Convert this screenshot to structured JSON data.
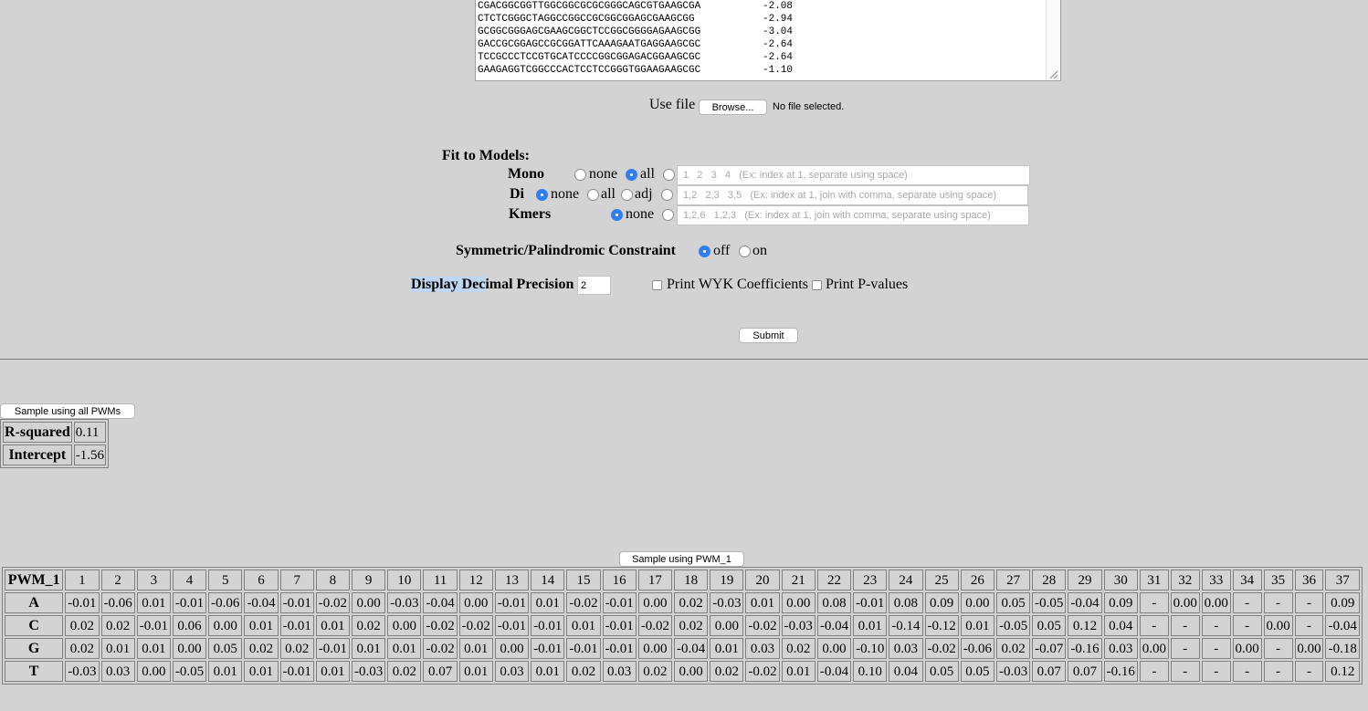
{
  "sequences": [
    {
      "seq": "CGACGGCGGTTGGCGGCGCGCGGGCAGCGTGAAGCGA",
      "score": "-2.08"
    },
    {
      "seq": "CTCTCGGGCTAGGCCGGCCGCGGCGGAGCGAAGCGG",
      "score": "-2.94"
    },
    {
      "seq": "GCGGCGGGAGCGAAGCGGCTCCGGCGGGGAGAAGCGG",
      "score": "-3.04"
    },
    {
      "seq": "GACCGCGGAGCCGCGGATTCAAAGAATGAGGAAGCGC",
      "score": "-2.64"
    },
    {
      "seq": "TCCGCCCTCCGTGCATCCCCGGCGGAGACGGAAGCGC",
      "score": "-2.64"
    },
    {
      "seq": "GAAGAGGTCGGCCCACTCCTCCGGGTGGAAGAAGCGC",
      "score": "-1.10"
    }
  ],
  "file": {
    "label": "Use file",
    "browse": "Browse...",
    "status": "No file selected."
  },
  "fit": {
    "title": "Fit to Models:",
    "mono": {
      "label": "Mono",
      "none": "none",
      "all": "all",
      "placeholder": "1   2   3   4   (Ex: index at 1, separate using space)"
    },
    "di": {
      "label": "Di",
      "none": "none",
      "all": "all",
      "adj": "adj",
      "placeholder": "1,2   2,3   3,5   (Ex: index at 1, join with comma, separate using space)"
    },
    "kmers": {
      "label": "Kmers",
      "none": "none",
      "placeholder": "1,2,6   1,2,3   (Ex: index at 1, join with comma, separate using space)"
    }
  },
  "symmetric": {
    "label": "Symmetric/Palindromic Constraint",
    "off": "off",
    "on": "on"
  },
  "precision": {
    "label_highlight": "Display Dec",
    "label_rest": "imal Precision",
    "value": "2"
  },
  "print_wyk": "Print WYK Coefficients",
  "print_pvalues": "Print P-values",
  "submit": "Submit",
  "sample_all": "Sample using all PWMs",
  "stats": [
    {
      "label": "R-squared",
      "value": "0.11"
    },
    {
      "label": "Intercept",
      "value": "-1.56"
    }
  ],
  "sample_pwm1": "Sample using PWM_1",
  "pwm": {
    "name": "PWM_1",
    "positions": [
      "1",
      "2",
      "3",
      "4",
      "5",
      "6",
      "7",
      "8",
      "9",
      "10",
      "11",
      "12",
      "13",
      "14",
      "15",
      "16",
      "17",
      "18",
      "19",
      "20",
      "21",
      "22",
      "23",
      "24",
      "25",
      "26",
      "27",
      "28",
      "29",
      "30",
      "31",
      "32",
      "33",
      "34",
      "35",
      "36",
      "37"
    ],
    "rows": [
      {
        "base": "A",
        "values": [
          "-0.01",
          "-0.06",
          "0.01",
          "-0.01",
          "-0.06",
          "-0.04",
          "-0.01",
          "-0.02",
          "0.00",
          "-0.03",
          "-0.04",
          "0.00",
          "-0.01",
          "0.01",
          "-0.02",
          "-0.01",
          "0.00",
          "0.02",
          "-0.03",
          "0.01",
          "0.00",
          "0.08",
          "-0.01",
          "0.08",
          "0.09",
          "0.00",
          "0.05",
          "-0.05",
          "-0.04",
          "0.09",
          "-",
          "0.00",
          "0.00",
          "-",
          "-",
          "-",
          "0.09"
        ]
      },
      {
        "base": "C",
        "values": [
          "0.02",
          "0.02",
          "-0.01",
          "0.06",
          "0.00",
          "0.01",
          "-0.01",
          "0.01",
          "0.02",
          "0.00",
          "-0.02",
          "-0.02",
          "-0.01",
          "-0.01",
          "0.01",
          "-0.01",
          "-0.02",
          "0.02",
          "0.00",
          "-0.02",
          "-0.03",
          "-0.04",
          "0.01",
          "-0.14",
          "-0.12",
          "0.01",
          "-0.05",
          "0.05",
          "0.12",
          "0.04",
          "-",
          "-",
          "-",
          "-",
          "0.00",
          "-",
          "-0.04"
        ]
      },
      {
        "base": "G",
        "values": [
          "0.02",
          "0.01",
          "0.01",
          "0.00",
          "0.05",
          "0.02",
          "0.02",
          "-0.01",
          "0.01",
          "0.01",
          "-0.02",
          "0.01",
          "0.00",
          "-0.01",
          "-0.01",
          "-0.01",
          "0.00",
          "-0.04",
          "0.01",
          "0.03",
          "0.02",
          "0.00",
          "-0.10",
          "0.03",
          "-0.02",
          "-0.06",
          "0.02",
          "-0.07",
          "-0.16",
          "0.03",
          "0.00",
          "-",
          "-",
          "0.00",
          "-",
          "0.00",
          "-0.18"
        ]
      },
      {
        "base": "T",
        "values": [
          "-0.03",
          "0.03",
          "0.00",
          "-0.05",
          "0.01",
          "0.01",
          "-0.01",
          "0.01",
          "-0.03",
          "0.02",
          "0.07",
          "0.01",
          "0.03",
          "0.01",
          "0.02",
          "0.03",
          "0.02",
          "0.00",
          "0.02",
          "-0.02",
          "0.01",
          "-0.04",
          "0.10",
          "0.04",
          "0.05",
          "0.05",
          "-0.03",
          "0.07",
          "0.07",
          "-0.16",
          "-",
          "-",
          "-",
          "-",
          "-",
          "-",
          "0.12"
        ]
      }
    ]
  }
}
